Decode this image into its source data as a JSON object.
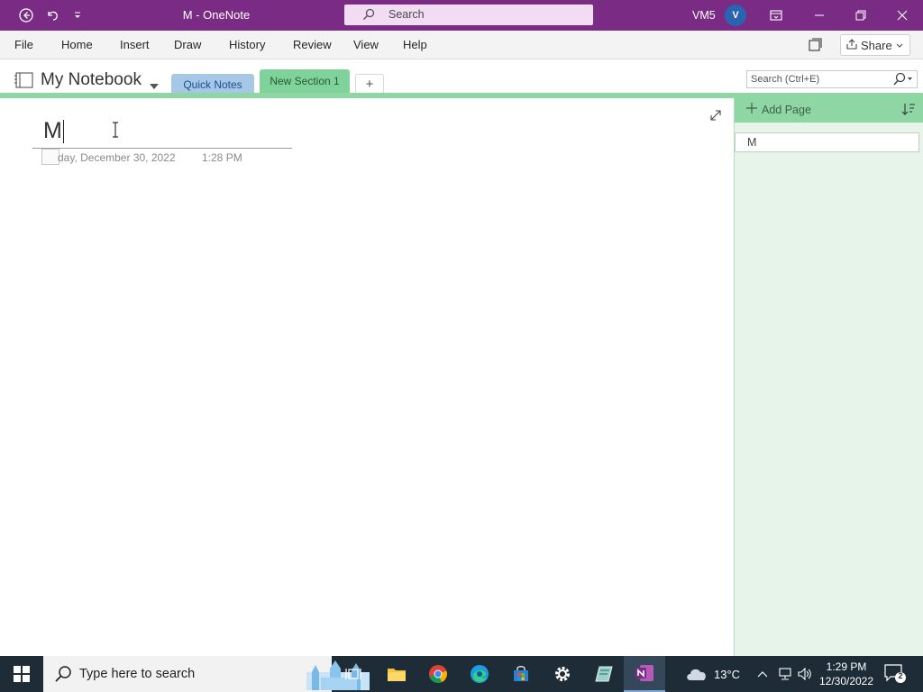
{
  "titlebar": {
    "title": "M  -  OneNote",
    "search_label": "Search",
    "user": "VM5",
    "avatar_initial": "V",
    "color": "#7a2c84"
  },
  "menu": {
    "tabs": [
      "File",
      "Home",
      "Insert",
      "Draw",
      "History",
      "Review",
      "View",
      "Help"
    ],
    "share_label": "Share"
  },
  "notebook": {
    "name": "My Notebook",
    "sections": [
      {
        "label": "Quick Notes",
        "color": "#a7c7e7"
      },
      {
        "label": "New Section 1",
        "color": "#7fd39a"
      }
    ],
    "add_section": "+",
    "search_placeholder": "Search (Ctrl+E)"
  },
  "page": {
    "title": "M",
    "date": "day, December 30, 2022",
    "time": "1:28 PM"
  },
  "pagelist": {
    "add_page_label": "Add Page",
    "pages": [
      "M"
    ]
  },
  "taskbar": {
    "search_placeholder": "Type here to search",
    "weather": "13°C",
    "time": "1:29 PM",
    "date": "12/30/2022",
    "notifications": "2"
  }
}
